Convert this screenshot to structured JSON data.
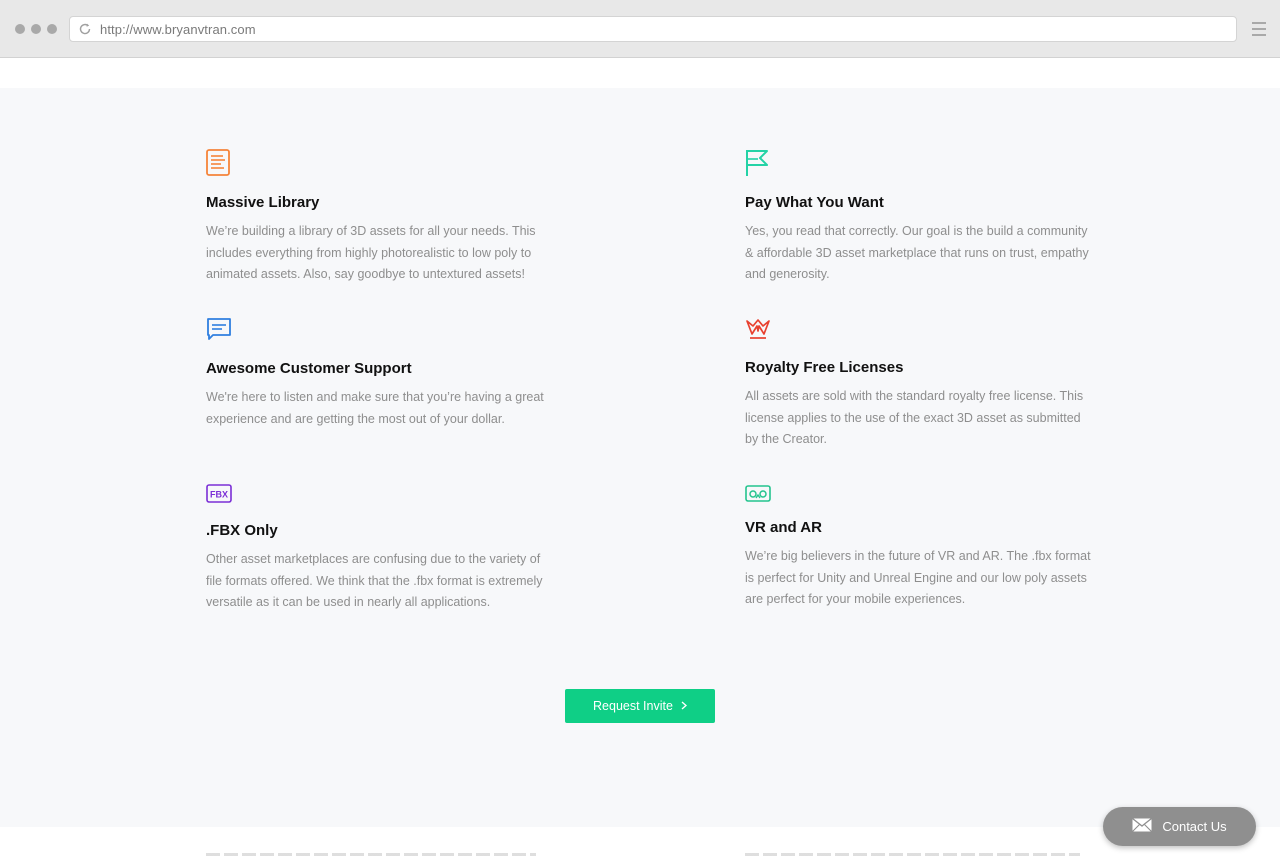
{
  "browser": {
    "url": "http://www.bryanvtran.com"
  },
  "features": [
    {
      "title": "Massive Library",
      "description": "We’re building a library of 3D assets for all your needs. This includes everything from highly photorealistic to low poly to animated assets. Also, say goodbye to untextured assets!",
      "icon": "document-icon",
      "color": "#f5843a"
    },
    {
      "title": "Pay What You Want",
      "description": "Yes, you read that correctly. Our goal is the build a community & affordable 3D asset marketplace that runs on trust, empathy and generosity.",
      "icon": "flag-icon",
      "color": "#24d3a6"
    },
    {
      "title": "Awesome Customer Support",
      "description": "We're here to listen and make sure that you’re having a great experience and are getting the most out of your dollar.",
      "icon": "chat-bubble-icon",
      "color": "#2f7fe0"
    },
    {
      "title": "Royalty Free Licenses",
      "description": "All assets are sold with the standard royalty free license. This license applies to the use of the exact 3D asset as submitted by the Creator.",
      "icon": "crown-icon",
      "color": "#e8402f"
    },
    {
      "title": ".FBX Only",
      "description": "Other asset marketplaces are confusing due to the variety of file formats offered. We think that the .fbx format is extremely versatile as it can be used in nearly all applications.",
      "icon": "fbx-icon",
      "icon_text": "FBX",
      "color": "#7b2fd6"
    },
    {
      "title": "VR and AR",
      "description": "We’re big believers in the future of VR and AR. The .fbx format is perfect for Unity and Unreal Engine and our low poly assets are perfect for your mobile experiences.",
      "icon": "vr-headset-icon",
      "color": "#24c48e"
    }
  ],
  "cta": {
    "label": "Request Invite",
    "icon": "chevron-right-icon",
    "color": "#0fcf86"
  },
  "contact": {
    "label": "Contact Us",
    "icon": "envelope-icon"
  }
}
